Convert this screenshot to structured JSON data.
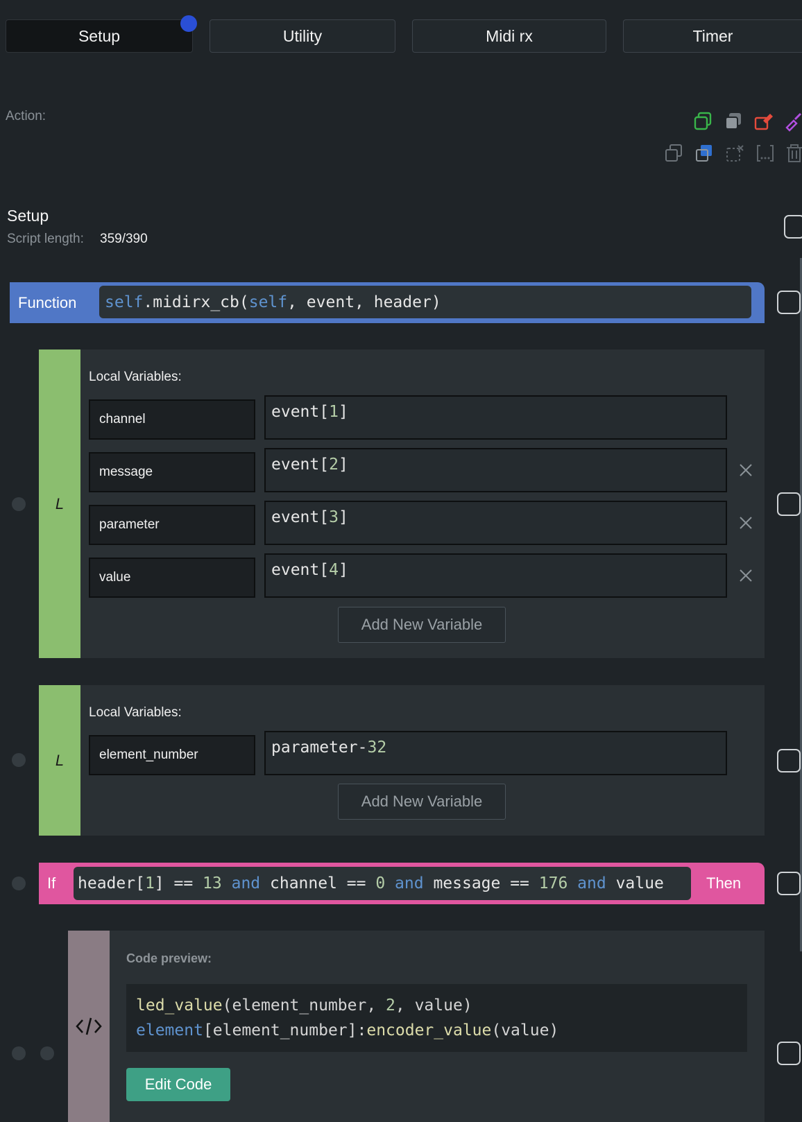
{
  "tabs": [
    {
      "label": "Setup",
      "active": true
    },
    {
      "label": "Utility",
      "active": false
    },
    {
      "label": "Midi rx",
      "active": false
    },
    {
      "label": "Timer",
      "active": false
    }
  ],
  "action_label": "Action:",
  "toolbar_icons": [
    "copy-green-icon",
    "stack-gray-icon",
    "eraser-red-icon",
    "brush-purple-icon",
    "copy-outline-icon",
    "copy-blue-icon",
    "dashed-cut-icon",
    "bracket-dots-icon",
    "trash-icon"
  ],
  "section": {
    "title": "Setup",
    "script_length_label": "Script length:",
    "script_length_value": "359/390"
  },
  "function_block": {
    "label": "Function",
    "code_tokens": {
      "self1": "self",
      "mid": ".midirx_cb(",
      "self2": "self",
      "rest": ", event, header)"
    }
  },
  "locals_1": {
    "title": "Local Variables:",
    "marker": "L",
    "vars": [
      {
        "name": "channel",
        "value_prefix": "event[",
        "value_num": "1",
        "value_suffix": "]"
      },
      {
        "name": "message",
        "value_prefix": "event[",
        "value_num": "2",
        "value_suffix": "]"
      },
      {
        "name": "parameter",
        "value_prefix": "event[",
        "value_num": "3",
        "value_suffix": "]"
      },
      {
        "name": "value",
        "value_prefix": "event[",
        "value_num": "4",
        "value_suffix": "]"
      }
    ],
    "add_button": "Add New Variable"
  },
  "locals_2": {
    "title": "Local Variables:",
    "marker": "L",
    "vars": [
      {
        "name": "element_number",
        "value_prefix": "parameter-",
        "value_num": "32"
      }
    ],
    "add_button": "Add New Variable"
  },
  "if_block": {
    "label": "If",
    "then_label": "Then",
    "tokens": {
      "t1": "header[",
      "n1": "1",
      "t2": "] == ",
      "n2": "13",
      "k1": " and ",
      "t3": "channel == ",
      "n3": "0",
      "k2": " and ",
      "t4": "message == ",
      "n4": "176",
      "k3": " and ",
      "t5": "value"
    }
  },
  "code_block": {
    "preview_label": "Code preview:",
    "line1": {
      "fn": "led_value",
      "a": "(element_number, ",
      "num": "2",
      "b": ", value)"
    },
    "line2": {
      "kw": "element",
      "a": "[element_number]:",
      "fn": "encoder_value",
      "b": "(value)"
    },
    "edit_button": "Edit Code"
  },
  "colors": {
    "function_bar": "#5077c6",
    "locals_stripe": "#8bbe6f",
    "if_bar": "#e0569f",
    "code_stripe": "#8a7c84",
    "edit_button": "#3ea085",
    "tab_dot": "#2a4fd6"
  }
}
